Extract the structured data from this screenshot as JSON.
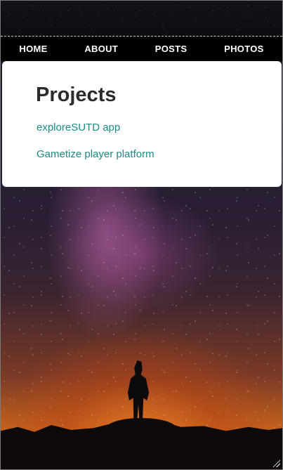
{
  "nav": {
    "items": [
      {
        "label": "HOME"
      },
      {
        "label": "ABOUT"
      },
      {
        "label": "POSTS"
      },
      {
        "label": "PHOTOS"
      }
    ]
  },
  "projects": {
    "title": "Projects",
    "links": [
      {
        "label": "exploreSUTD app"
      },
      {
        "label": "Gametize player platform"
      }
    ]
  },
  "colors": {
    "nav_background": "#000000",
    "nav_text": "#ffffff",
    "card_background": "#ffffff",
    "title": "#2b2b2b",
    "link": "#1a8a84"
  },
  "icons": {
    "resize": "resize-grip-icon"
  }
}
